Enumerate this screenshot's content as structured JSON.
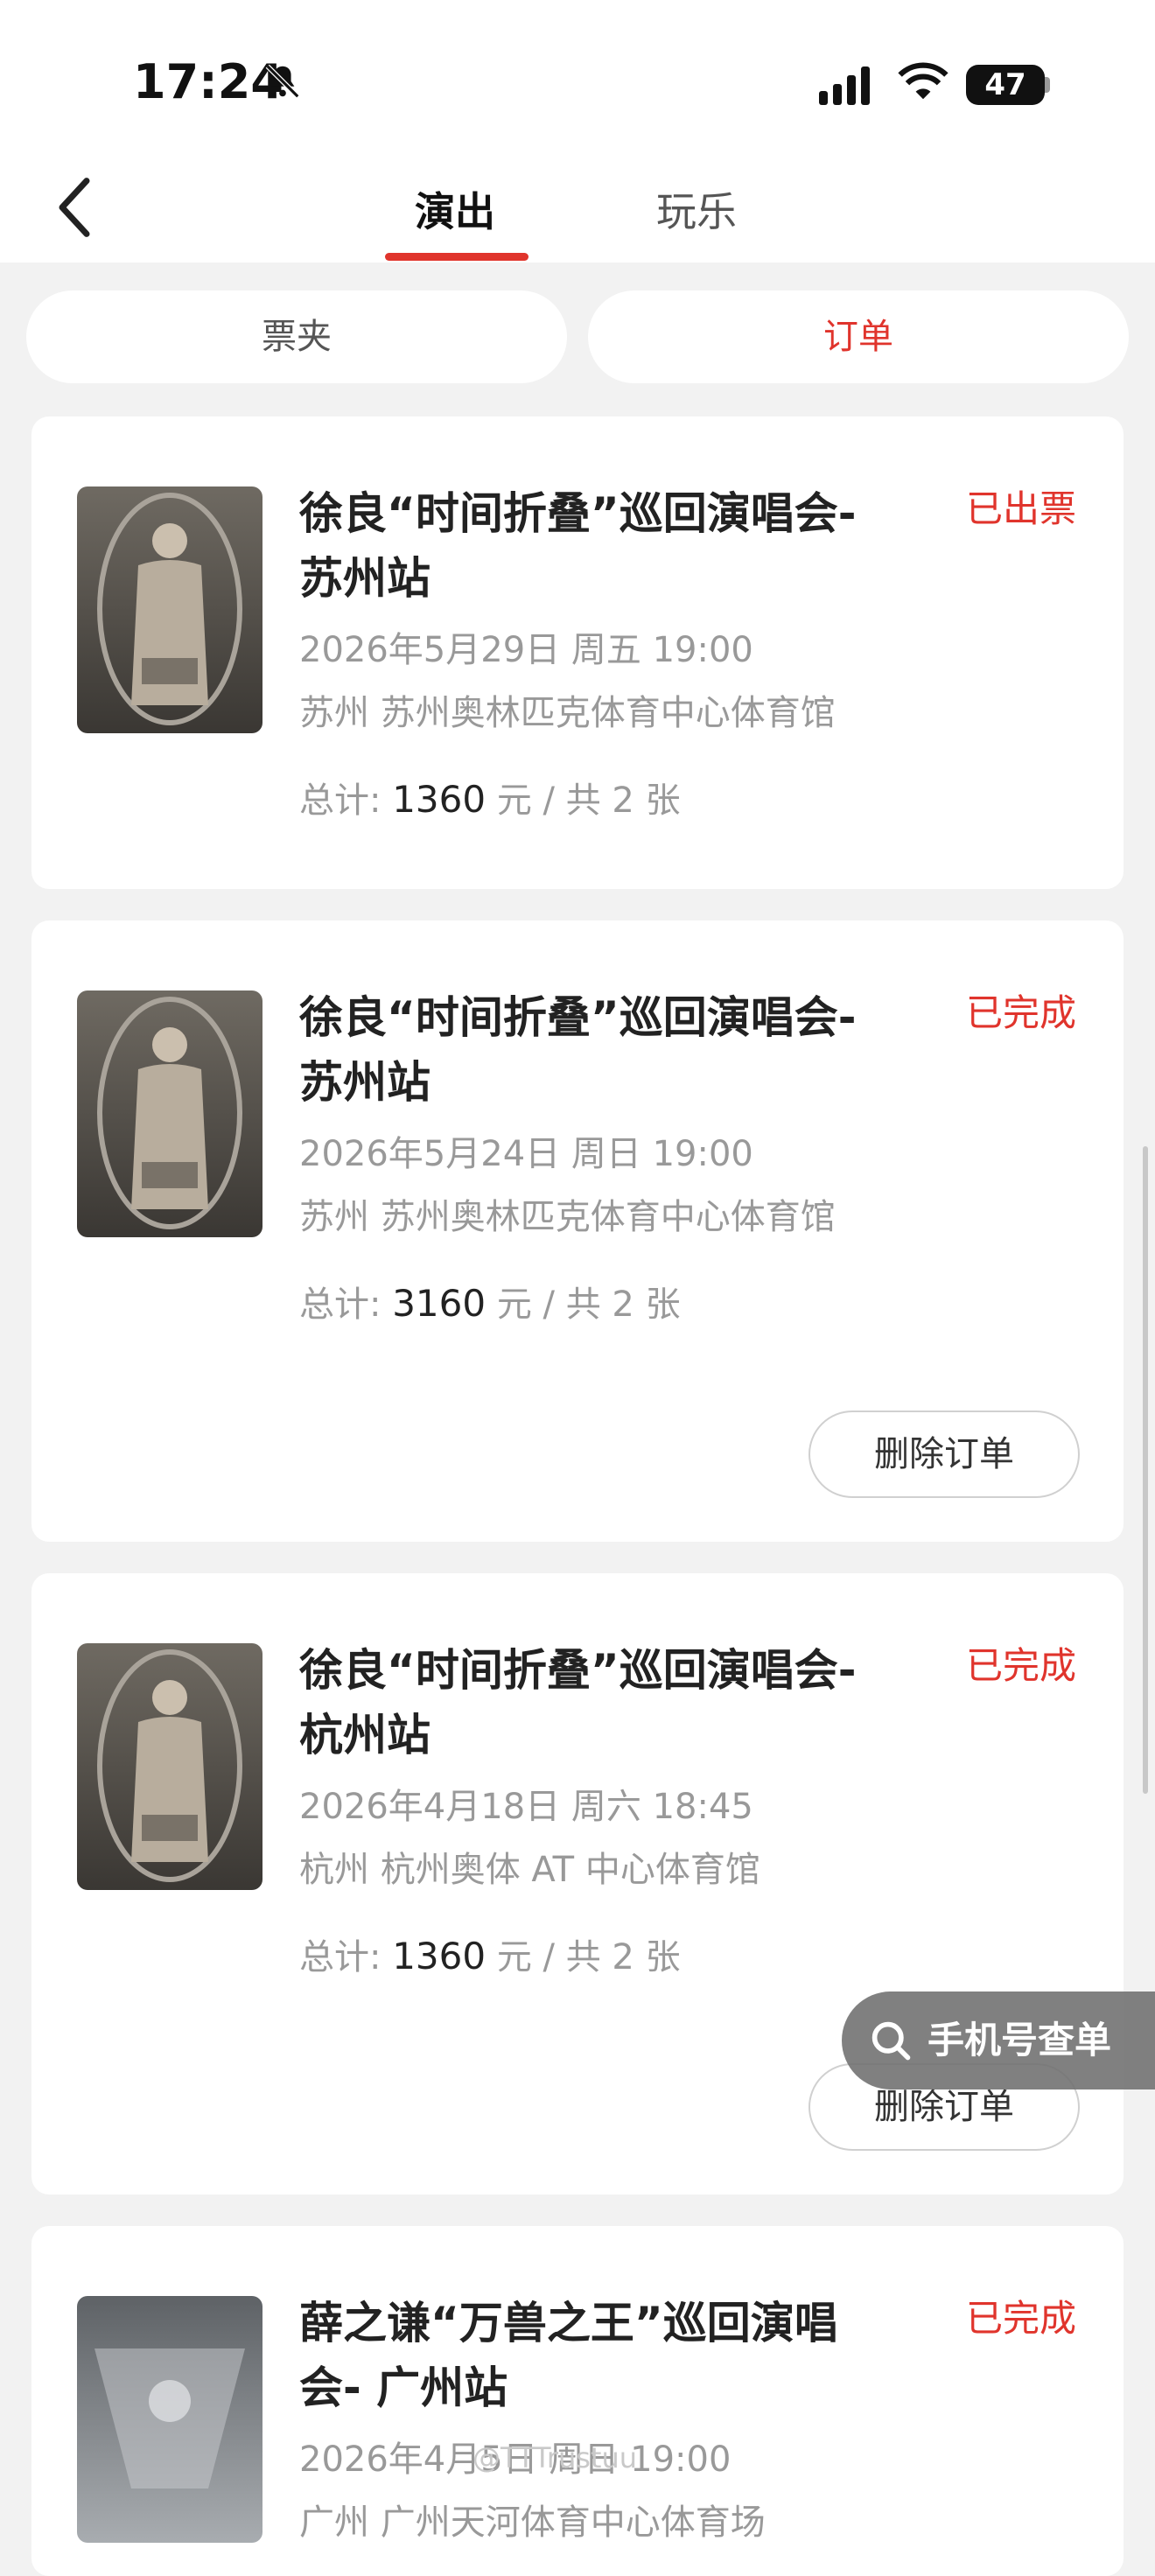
{
  "status_bar": {
    "time": "17:24",
    "battery": "47"
  },
  "nav": {
    "tabs": [
      {
        "label": "演出",
        "active": true
      },
      {
        "label": "玩乐",
        "active": false
      }
    ]
  },
  "segments": [
    {
      "label": "票夹",
      "active": false
    },
    {
      "label": "订单",
      "active": true
    }
  ],
  "orders": [
    {
      "title": "徐良“时间折叠”巡回演唱会-苏州站",
      "status": "已出票",
      "date": "2026年5月29日 周五 19:00",
      "venue": "苏州 苏州奥林匹克体育中心体育馆",
      "total_prefix": "总计:",
      "total_amount": "1360",
      "total_suffix": "元 / 共 2 张",
      "delete_label": ""
    },
    {
      "title": "徐良“时间折叠”巡回演唱会-苏州站",
      "status": "已完成",
      "date": "2026年5月24日 周日 19:00",
      "venue": "苏州 苏州奥林匹克体育中心体育馆",
      "total_prefix": "总计:",
      "total_amount": "3160",
      "total_suffix": "元 / 共 2 张",
      "delete_label": "删除订单"
    },
    {
      "title": "徐良“时间折叠”巡回演唱会-杭州站",
      "status": "已完成",
      "date": "2026年4月18日 周六 18:45",
      "venue": "杭州 杭州奥体 AT 中心体育馆",
      "total_prefix": "总计:",
      "total_amount": "1360",
      "total_suffix": "元 / 共 2 张",
      "delete_label": "删除订单"
    },
    {
      "title": "薛之谦“万兽之王”巡回演唱会- 广州站",
      "status": "已完成",
      "date": "2026年4月5日 周日 19:00",
      "venue": "广州 广州天河体育中心体育场",
      "total_prefix": "",
      "total_amount": "",
      "total_suffix": "",
      "delete_label": ""
    }
  ],
  "float_button": {
    "label": "手机号查单"
  },
  "watermark": "@TTTrustuu",
  "colors": {
    "accent": "#e0342c",
    "background": "#f2f2f2",
    "card": "#ffffff"
  },
  "icons": [
    "back-chevron-icon",
    "mute-bell-icon",
    "signal-icon",
    "wifi-icon",
    "battery-icon",
    "search-icon"
  ]
}
